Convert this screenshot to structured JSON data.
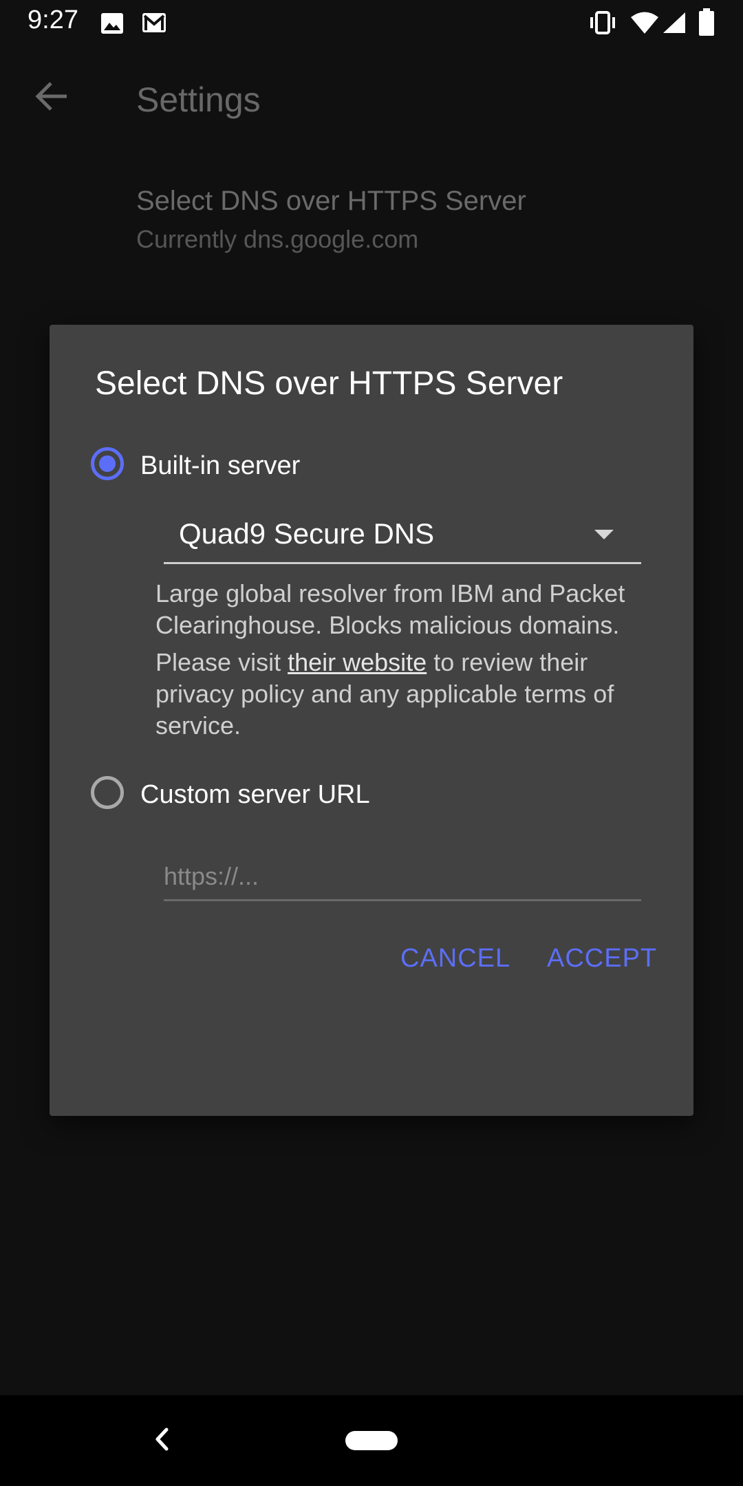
{
  "status_bar": {
    "time": "9:27",
    "left_icons": [
      "image-icon",
      "gmail-icon"
    ],
    "right_icons": [
      "vibrate-icon",
      "wifi-icon",
      "signal-icon",
      "battery-icon"
    ]
  },
  "app_bar": {
    "title": "Settings",
    "back_icon": "arrow-back-icon"
  },
  "preference": {
    "title": "Select DNS over HTTPS Server",
    "summary": "Currently dns.google.com"
  },
  "dialog": {
    "title": "Select DNS over HTTPS Server",
    "options": [
      {
        "label": "Built-in server",
        "checked": true
      },
      {
        "label": "Custom server URL",
        "checked": false
      }
    ],
    "dropdown": {
      "selected": "Quad9 Secure DNS"
    },
    "description": {
      "line1": "Large global resolver from IBM and Packet Clearinghouse. Blocks malicious domains.",
      "line2_before": "Please visit ",
      "link_text": "their website",
      "line2_after": " to review their privacy policy and any applicable terms of service."
    },
    "custom_url": {
      "value": "",
      "placeholder": "https://..."
    },
    "buttons": {
      "cancel": "CANCEL",
      "accept": "ACCEPT"
    },
    "accent_color": "#5c6ef8"
  },
  "nav_bar": {
    "icons": [
      "nav-back-icon",
      "home-pill-icon"
    ]
  }
}
